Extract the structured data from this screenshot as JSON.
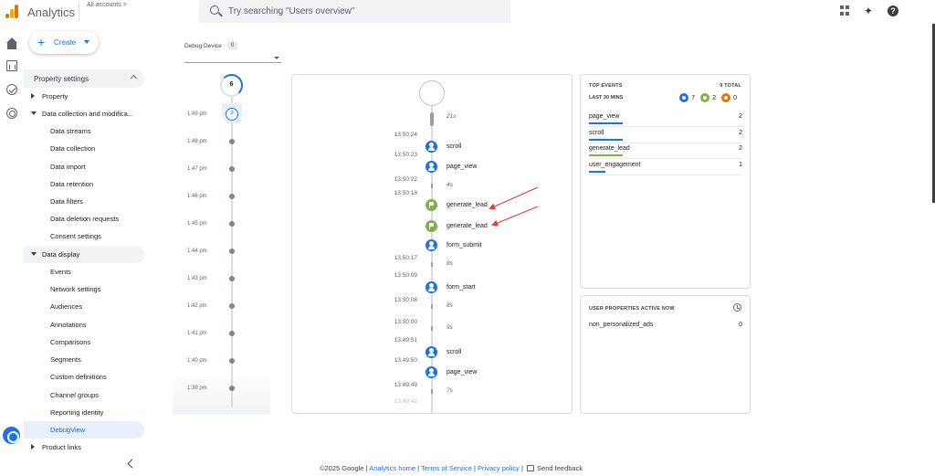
{
  "header": {
    "app_title": "Analytics",
    "accounts_label": "All accounts",
    "accounts_chevron": ">",
    "search_placeholder": "Try searching \"Users overview\"",
    "help_glyph": "?",
    "sparkle_glyph": "✦"
  },
  "create": {
    "label": "Create",
    "plus": "+"
  },
  "sidebar": {
    "header": "Property settings",
    "items": [
      {
        "label": "Property",
        "type": "group",
        "state": "collapsed"
      },
      {
        "label": "Data collection and modifica...",
        "type": "group",
        "state": "expanded"
      },
      {
        "label": "Data streams",
        "type": "sub"
      },
      {
        "label": "Data collection",
        "type": "sub"
      },
      {
        "label": "Data import",
        "type": "sub"
      },
      {
        "label": "Data retention",
        "type": "sub"
      },
      {
        "label": "Data filters",
        "type": "sub"
      },
      {
        "label": "Data deletion requests",
        "type": "sub"
      },
      {
        "label": "Consent settings",
        "type": "sub"
      },
      {
        "label": "Data display",
        "type": "group",
        "state": "expanded"
      },
      {
        "label": "Events",
        "type": "sub"
      },
      {
        "label": "Network settings",
        "type": "sub"
      },
      {
        "label": "Audiences",
        "type": "sub"
      },
      {
        "label": "Annotations",
        "type": "sub"
      },
      {
        "label": "Comparisons",
        "type": "sub"
      },
      {
        "label": "Segments",
        "type": "sub"
      },
      {
        "label": "Custom definitions",
        "type": "sub"
      },
      {
        "label": "Channel groups",
        "type": "sub"
      },
      {
        "label": "Reporting identity",
        "type": "sub"
      },
      {
        "label": "DebugView",
        "type": "sub",
        "selected": true
      },
      {
        "label": "Product links",
        "type": "group",
        "state": "collapsed"
      }
    ]
  },
  "debug_device": {
    "label": "Debug Device",
    "count": "0"
  },
  "minutes_stream": {
    "seconds_ring": "6",
    "current_count": "3",
    "rows": [
      "1:49 pm",
      "1:48 pm",
      "1:47 pm",
      "1:46 pm",
      "1:45 pm",
      "1:44 pm",
      "1:43 pm",
      "1:42 pm",
      "1:41 pm",
      "1:40 pm",
      "1:39 pm"
    ]
  },
  "seconds_stream": {
    "items": [
      {
        "kind": "gap",
        "label": "21s"
      },
      {
        "kind": "event",
        "time": "13:50:24",
        "name": "scroll",
        "icon": "blue"
      },
      {
        "kind": "event",
        "time": "13:50:23",
        "name": "page_view",
        "icon": "blue"
      },
      {
        "kind": "gap",
        "time": "13:50:22",
        "label": "4s"
      },
      {
        "kind": "event",
        "time": "13:50:18",
        "name": "generate_lead",
        "icon": "green"
      },
      {
        "kind": "event",
        "time": "",
        "name": "generate_lead",
        "icon": "green"
      },
      {
        "kind": "event",
        "time": "",
        "name": "form_submit",
        "icon": "blue"
      },
      {
        "kind": "gap",
        "time": "13:50:17",
        "label": "8s"
      },
      {
        "kind": "event",
        "time": "13:50:09",
        "name": "form_start",
        "icon": "blue"
      },
      {
        "kind": "gap",
        "time": "13:50:08",
        "label": "8s"
      },
      {
        "kind": "gap",
        "time": "13:50:00",
        "label": "9s"
      },
      {
        "kind": "event",
        "time": "13:49:51",
        "name": "scroll",
        "icon": "blue"
      },
      {
        "kind": "event",
        "time": "13:49:50",
        "name": "page_view",
        "icon": "blue"
      },
      {
        "kind": "gap",
        "time": "13:49:49",
        "label": "7s"
      },
      {
        "kind": "partial",
        "time": "13:49:42"
      }
    ]
  },
  "top_events": {
    "title": "TOP EVENTS",
    "total": "9 TOTAL",
    "subtitle": "LAST 30 MINS",
    "legend": [
      {
        "color": "blue",
        "count": "7"
      },
      {
        "color": "green",
        "count": "2"
      },
      {
        "color": "orange",
        "count": "0"
      }
    ],
    "rows": [
      {
        "name": "page_view",
        "count": "2",
        "bar": "blue",
        "fraction": 0.4
      },
      {
        "name": "scroll",
        "count": "2",
        "bar": "blue",
        "fraction": 0.4
      },
      {
        "name": "generate_lead",
        "count": "2",
        "bar": "green",
        "fraction": 0.4
      },
      {
        "name": "user_engagement",
        "count": "1",
        "bar": "blue",
        "fraction": 0.2
      }
    ]
  },
  "user_properties": {
    "title": "USER PROPERTIES ACTIVE NOW",
    "rows": [
      {
        "name": "non_personalized_ads",
        "value": "0"
      }
    ]
  },
  "footer": {
    "copyright": "©2025 Google |",
    "links": [
      "Analytics home",
      "Terms of Service",
      "Privacy policy"
    ],
    "sep": "|",
    "feedback": "Send feedback"
  },
  "colors": {
    "accent": "#1a73e8",
    "event_blue": "#1a73e8",
    "event_green": "#7cb342",
    "event_orange": "#e8710a",
    "annotation_arrow": "#e53935"
  }
}
